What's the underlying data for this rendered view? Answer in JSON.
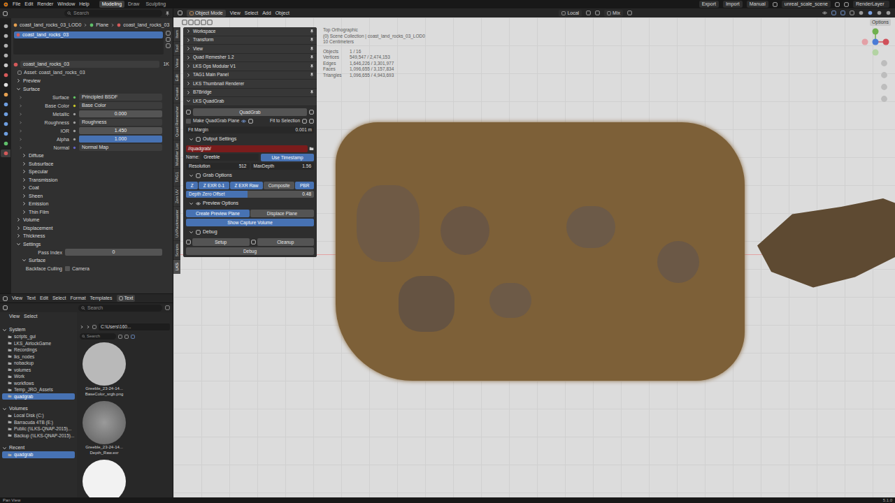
{
  "topbar": {
    "menus": [
      "File",
      "Edit",
      "Render",
      "Window",
      "Help"
    ],
    "workspaces": [
      {
        "label": "Modeling",
        "selected": true
      },
      {
        "label": "Draw",
        "selected": false
      },
      {
        "label": "Sculpting",
        "selected": false
      }
    ],
    "actions": [
      "Export",
      "Import",
      "Manual"
    ],
    "scene": "unreal_scale_scene",
    "view_layer": "RenderLayer"
  },
  "properties": {
    "search": {
      "placeholder": "Search"
    },
    "tabs": [
      {
        "color": "#b0b0b0",
        "selected": false
      },
      {
        "color": "#b0b0b0",
        "selected": false
      },
      {
        "color": "#b0b0b0",
        "selected": false
      },
      {
        "color": "#b0b0b0",
        "selected": false
      },
      {
        "color": "#c8c8c8",
        "selected": false
      },
      {
        "color": "#d65a5a",
        "selected": false
      },
      {
        "color": "#e0e0e0",
        "selected": false
      },
      {
        "color": "#e5a050",
        "selected": false
      },
      {
        "color": "#6e9ee0",
        "selected": false
      },
      {
        "color": "#6e9ee0",
        "selected": false
      },
      {
        "color": "#6e9ee0",
        "selected": false
      },
      {
        "color": "#6e9ee0",
        "selected": false
      },
      {
        "color": "#5fbf6a",
        "selected": false
      },
      {
        "color": "#d35a5a",
        "selected": true
      }
    ],
    "breadcrumb": [
      "coast_land_rocks_03_LOD0",
      "Plane",
      "coast_land_rocks_03"
    ],
    "slots": [
      {
        "label": "coast_land_rocks_03",
        "selected": true
      }
    ],
    "material": {
      "name": "coast_land_rocks_03",
      "users": "1K"
    },
    "asset": "Asset: coast_land_rocks_03",
    "rows": [
      {
        "kind": "panel",
        "label": "Preview",
        "expanded": false,
        "depth": 0
      },
      {
        "kind": "panel",
        "label": "Surface",
        "expanded": true,
        "depth": 0
      },
      {
        "kind": "link",
        "label": "Surface",
        "value": "Principled BSDF",
        "color": "#63c763"
      },
      {
        "kind": "link",
        "label": "Base Color",
        "value": "Base Color",
        "color": "#c7c729"
      },
      {
        "kind": "number",
        "label": "Metallic",
        "value": "0.000",
        "level": 0,
        "color": "#a1a1a1"
      },
      {
        "kind": "link",
        "label": "Roughness",
        "value": "Roughness",
        "color": "#a1a1a1"
      },
      {
        "kind": "number",
        "label": "IOR",
        "value": "1.450",
        "level": 0,
        "color": "#a1a1a1"
      },
      {
        "kind": "number",
        "label": "Alpha",
        "value": "1.000",
        "level": 1,
        "color": "#a1a1a1"
      },
      {
        "kind": "link",
        "label": "Normal",
        "value": "Normal Map",
        "color": "#6363c7"
      },
      {
        "kind": "panel",
        "label": "Diffuse",
        "expanded": false,
        "depth": 1
      },
      {
        "kind": "panel",
        "label": "Subsurface",
        "expanded": false,
        "depth": 1
      },
      {
        "kind": "panel",
        "label": "Specular",
        "expanded": false,
        "depth": 1
      },
      {
        "kind": "panel",
        "label": "Transmission",
        "expanded": false,
        "depth": 1
      },
      {
        "kind": "panel",
        "label": "Coat",
        "expanded": false,
        "depth": 1
      },
      {
        "kind": "panel",
        "label": "Sheen",
        "expanded": false,
        "depth": 1
      },
      {
        "kind": "panel",
        "label": "Emission",
        "expanded": false,
        "depth": 1
      },
      {
        "kind": "panel",
        "label": "Thin Film",
        "expanded": false,
        "depth": 1
      },
      {
        "kind": "panel",
        "label": "Volume",
        "expanded": false,
        "depth": 0
      },
      {
        "kind": "panel",
        "label": "Displacement",
        "expanded": false,
        "depth": 0
      },
      {
        "kind": "panel",
        "label": "Thickness",
        "expanded": false,
        "depth": 0
      },
      {
        "kind": "panel",
        "label": "Settings",
        "expanded": true,
        "depth": 0
      },
      {
        "kind": "integer",
        "label": "Pass Index",
        "value": "0"
      },
      {
        "kind": "panel",
        "label": "Surface",
        "expanded": true,
        "depth": 1
      },
      {
        "kind": "check",
        "label": "Backface Culling",
        "value": "Camera",
        "checked": false
      }
    ]
  },
  "text_editor": {
    "menus": [
      "View",
      "Text",
      "Edit",
      "Select",
      "Format",
      "Templates"
    ],
    "new_button": "Text"
  },
  "file_browser": {
    "search": {
      "placeholder": "Search"
    },
    "menus": [
      "View",
      "Select"
    ],
    "path": "C:\\Users\\160...",
    "filter": {
      "placeholder": "Search"
    },
    "sections": [
      {
        "title": "System",
        "expanded": true,
        "items": [
          {
            "label": "scripts_gui",
            "selected": false
          },
          {
            "label": "LKS_AirlockGame",
            "selected": false
          },
          {
            "label": "Recordings",
            "selected": false
          },
          {
            "label": "lks_nodes",
            "selected": false
          },
          {
            "label": "nobackup",
            "selected": false
          },
          {
            "label": "volumes",
            "selected": false
          },
          {
            "label": "Work",
            "selected": false
          },
          {
            "label": "workflows",
            "selected": false
          },
          {
            "label": "Temp_JRO_Assets",
            "selected": false
          },
          {
            "label": "quadgrab",
            "selected": true
          }
        ]
      },
      {
        "title": "Volumes",
        "expanded": true,
        "items": [
          {
            "label": "Local Disk (C:)",
            "selected": false
          },
          {
            "label": "Barracuda 4TB (E:)",
            "selected": false
          },
          {
            "label": "Public (\\\\LKS-QNAP-2015)...",
            "selected": false
          },
          {
            "label": "Backup (\\\\LKS-QNAP-2015)...",
            "selected": false
          }
        ]
      },
      {
        "title": "Recent",
        "expanded": true,
        "items": [
          {
            "label": "quadgrab",
            "selected": true
          }
        ]
      }
    ],
    "files": [
      {
        "lines": [
          "Greeble_23-24-14...",
          "BaseColor_srgb.png"
        ],
        "kind": "flat"
      },
      {
        "lines": [
          "Greeble_23-24-14...",
          "Depth_Raw.exr"
        ],
        "kind": "radial"
      },
      {
        "lines": [],
        "kind": "bright"
      }
    ]
  },
  "viewport": {
    "header": {
      "mode": "Object Mode",
      "menus": [
        "View",
        "Select",
        "Add",
        "Object"
      ],
      "orientation": "Local",
      "pivot": "Mix"
    },
    "options": "Options",
    "tabs": [
      {
        "label": "Item",
        "selected": false
      },
      {
        "label": "Tool",
        "selected": false
      },
      {
        "label": "View",
        "selected": false
      },
      {
        "label": "Edit",
        "selected": false
      },
      {
        "label": "Create",
        "selected": false
      },
      {
        "label": "Quad Remesher",
        "selected": false
      },
      {
        "label": "Modifier List",
        "selected": false
      },
      {
        "label": "TAG1",
        "selected": false
      },
      {
        "label": "Zen UV",
        "selected": false
      },
      {
        "label": "UVPackmaster",
        "selected": false
      },
      {
        "label": "Scripts",
        "selected": false
      },
      {
        "label": "LKS",
        "selected": true
      }
    ],
    "sidebar": {
      "panels": [
        {
          "label": "Workspace",
          "expanded": false,
          "pinned": true
        },
        {
          "label": "Transform",
          "expanded": false,
          "pinned": true
        },
        {
          "label": "View",
          "expanded": false,
          "pinned": true
        },
        {
          "label": "Quad Remesher 1.2",
          "expanded": false,
          "pinned": true
        },
        {
          "label": "LKS Ops Modular V1",
          "expanded": false,
          "pinned": true
        },
        {
          "label": "TAG1 Main Panel",
          "expanded": false,
          "pinned": true
        },
        {
          "label": "LKS Thumbnail Renderer",
          "expanded": false,
          "pinned": false
        },
        {
          "label": "B7Bridge",
          "expanded": false,
          "pinned": true
        },
        {
          "label": "LKS QuadGrab",
          "expanded": true,
          "pinned": false
        }
      ],
      "quadgrab": {
        "grab_button": "QuadGrab",
        "make_plane": {
          "label": "Make QuadGrab Plane",
          "checked": false
        },
        "fit_selection": "Fit to Selection",
        "fit_margin": {
          "label": "Fit Margin",
          "value": "0.001 m"
        },
        "output": {
          "title": "Output Settings",
          "expanded": true,
          "path": "//quadgrab/",
          "path_alert": true,
          "name_label": "Name:",
          "name": "Greeble",
          "timestamp": {
            "label": "Use Timestamp",
            "on": true
          },
          "resolution": {
            "label": "Resolution",
            "value": "512"
          },
          "max_depth": {
            "label": "MaxDepth",
            "value": "1.56"
          }
        },
        "grab": {
          "title": "Grab Options",
          "expanded": true,
          "toggles": [
            {
              "label": "Z",
              "on": true
            },
            {
              "label": "Z EXR 0-1",
              "on": true
            },
            {
              "label": "Z EXR Raw",
              "on": true
            },
            {
              "label": "Composite",
              "on": false
            },
            {
              "label": "PBR",
              "on": true
            }
          ],
          "depth_offset": {
            "label": "Depth Zero Offset",
            "value": "0.48",
            "level": 0.48
          }
        },
        "preview": {
          "title": "Preview Options",
          "expanded": true,
          "toggles": [
            {
              "label": "Create Preview Plane",
              "on": true
            },
            {
              "label": "Displace Plane",
              "on": false
            }
          ],
          "capture": {
            "label": "Show Capture Volume",
            "on": true
          }
        },
        "debug": {
          "title": "Debug",
          "expanded": true,
          "buttons": [
            "Setup",
            "Cleanup"
          ],
          "debug_button": "Debug"
        }
      }
    },
    "overlay": {
      "title": "Top Orthographic",
      "collection": "(0) Scene Collection | coast_land_rocks_03_LOD0",
      "scale": "10 Centimeters",
      "stats": [
        {
          "label": "Objects",
          "value": "1 / 16"
        },
        {
          "label": "Vertices",
          "value": "549,547 / 2,474,153"
        },
        {
          "label": "Edges",
          "value": "1,646,226 / 3,301,977"
        },
        {
          "label": "Faces",
          "value": "1,096,655 / 3,157,834"
        },
        {
          "label": "Triangles",
          "value": "1,096,655 / 4,943,693"
        }
      ]
    }
  },
  "status_bar": {
    "left": "Pan View",
    "right": "5.1.0"
  }
}
